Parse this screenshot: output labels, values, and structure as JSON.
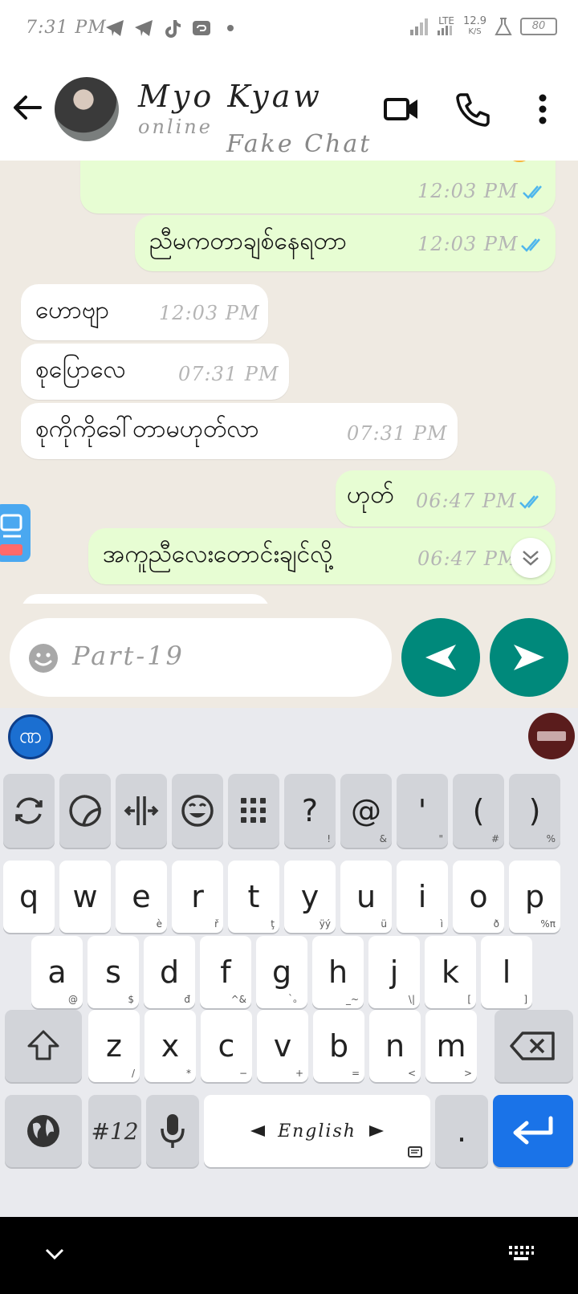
{
  "status_bar": {
    "time": "7:31 PM",
    "net_speed_value": "12.9",
    "net_speed_unit": "K/S",
    "network": "LTE",
    "battery": "80"
  },
  "header": {
    "contact_name": "Myo Kyaw",
    "contact_status": "online",
    "watermark": "Fake Chat"
  },
  "messages": [
    {
      "direction": "out",
      "text": "",
      "time": "12:03 PM",
      "ticks": "read"
    },
    {
      "direction": "out",
      "text": "ညီမကတာချစ်နေရတာ",
      "time": "12:03 PM",
      "ticks": "read"
    },
    {
      "direction": "in",
      "text": "ဟောဗျာ",
      "time": "12:03 PM"
    },
    {
      "direction": "in",
      "text": "စုပြောလေ",
      "time": "07:31 PM"
    },
    {
      "direction": "in",
      "text": "စုကိုကိုခေါ်တာမဟုတ်လာ",
      "time": "07:31 PM"
    },
    {
      "direction": "out",
      "text": "ဟုတ်",
      "time": "06:47 PM",
      "ticks": "read"
    },
    {
      "direction": "out",
      "text": "အကူညီလေးတောင်းချင်လို့",
      "time": "06:47 PM"
    }
  ],
  "composer": {
    "text": "Part-19"
  },
  "keyboard": {
    "row_tools": [
      {
        "icon": "refresh-icon"
      },
      {
        "icon": "sticker-icon"
      },
      {
        "icon": "cursor-move-icon"
      },
      {
        "icon": "smiley-icon"
      },
      {
        "icon": "numpad-icon"
      },
      {
        "main": "?",
        "sub": "!"
      },
      {
        "main": "@",
        "sub": "&"
      },
      {
        "main": "'",
        "sub": "\""
      },
      {
        "main": "(",
        "sub": "#"
      },
      {
        "main": ")",
        "sub": "%"
      }
    ],
    "row1": [
      {
        "main": "q",
        "sub": ""
      },
      {
        "main": "w",
        "sub": ""
      },
      {
        "main": "e",
        "sub": "è"
      },
      {
        "main": "r",
        "sub": "ř"
      },
      {
        "main": "t",
        "sub": "ţ"
      },
      {
        "main": "y",
        "sub": "ÿý"
      },
      {
        "main": "u",
        "sub": "ü"
      },
      {
        "main": "i",
        "sub": "ì"
      },
      {
        "main": "o",
        "sub": "ð"
      },
      {
        "main": "p",
        "sub": "%π"
      }
    ],
    "row2": [
      {
        "main": "a",
        "sub": "@"
      },
      {
        "main": "s",
        "sub": "$"
      },
      {
        "main": "d",
        "sub": "đ"
      },
      {
        "main": "f",
        "sub": "^&"
      },
      {
        "main": "g",
        "sub": "`。"
      },
      {
        "main": "h",
        "sub": "_~"
      },
      {
        "main": "j",
        "sub": "\\|"
      },
      {
        "main": "k",
        "sub": "["
      },
      {
        "main": "l",
        "sub": "]"
      }
    ],
    "row3": [
      {
        "main": "z",
        "sub": "/"
      },
      {
        "main": "x",
        "sub": "*"
      },
      {
        "main": "c",
        "sub": "−"
      },
      {
        "main": "v",
        "sub": "+"
      },
      {
        "main": "b",
        "sub": "="
      },
      {
        "main": "n",
        "sub": "<"
      },
      {
        "main": "m",
        "sub": ">"
      }
    ],
    "symbols_key": "#12",
    "space_label": "English",
    "period_key": "."
  },
  "colors": {
    "chat_bg": "#efeae2",
    "outgoing_bubble": "#e7fdd3",
    "incoming_bubble": "#ffffff",
    "accent": "#00897b",
    "tick_blue": "#4fb6ec",
    "enter_key": "#1a73e8"
  }
}
